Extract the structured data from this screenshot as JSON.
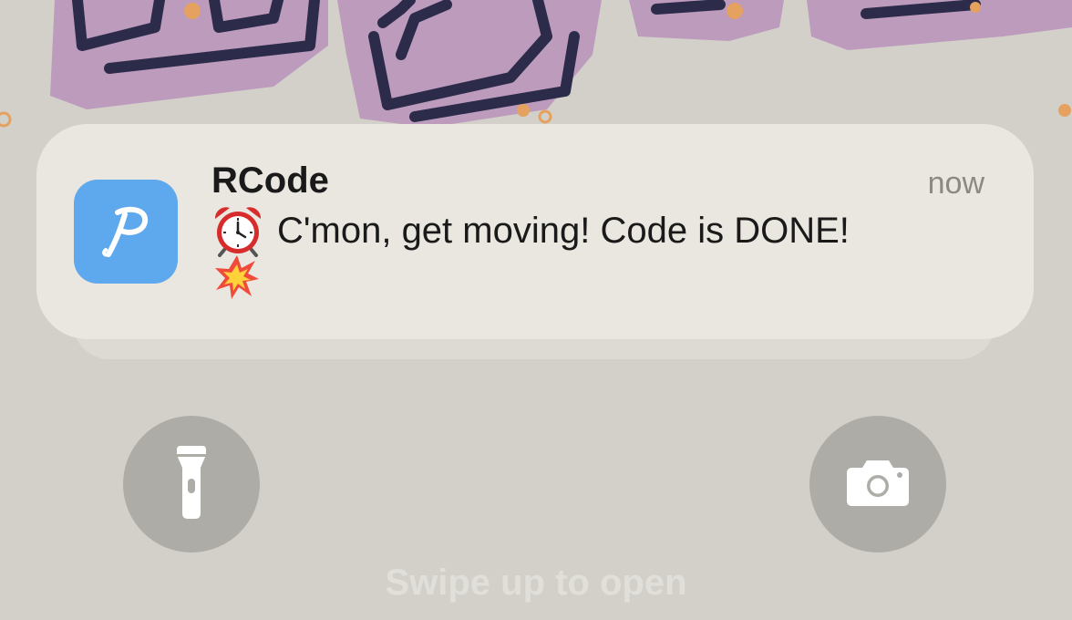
{
  "notification": {
    "app_name": "RCode",
    "time": "now",
    "message": "C'mon, get moving! Code is DONE!",
    "leading_icon": "alarm-clock-icon",
    "trailing_icon": "collision-icon",
    "app_icon": "rcode-app-icon",
    "app_icon_color": "#5ea8ee"
  },
  "lock_screen": {
    "swipe_hint": "Swipe up to open",
    "left_button_icon": "flashlight-icon",
    "right_button_icon": "camera-icon"
  }
}
